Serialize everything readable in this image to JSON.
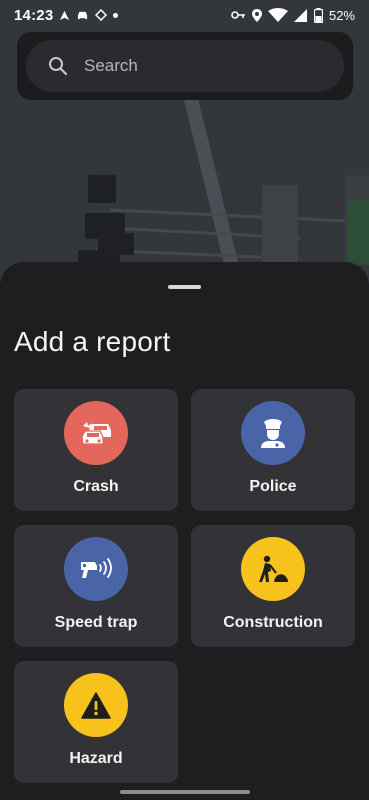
{
  "status_bar": {
    "time": "14:23",
    "battery": "52%",
    "icons": [
      "navigation-arrow-icon",
      "car-icon",
      "vpn-icon",
      "dot-icon",
      "key-icon",
      "location-icon",
      "wifi-icon",
      "signal-icon",
      "battery-icon"
    ]
  },
  "search": {
    "placeholder": "Search"
  },
  "sheet": {
    "title": "Add a report",
    "items": [
      {
        "label": "Crash",
        "icon": "crash-icon",
        "color": "#e3675a"
      },
      {
        "label": "Police",
        "icon": "police-icon",
        "color": "#4a64a8"
      },
      {
        "label": "Speed trap",
        "icon": "speed-trap-icon",
        "color": "#4a64a8"
      },
      {
        "label": "Construction",
        "icon": "construction-icon",
        "color": "#f7c21b"
      },
      {
        "label": "Hazard",
        "icon": "hazard-icon",
        "color": "#f7c21b"
      }
    ]
  }
}
